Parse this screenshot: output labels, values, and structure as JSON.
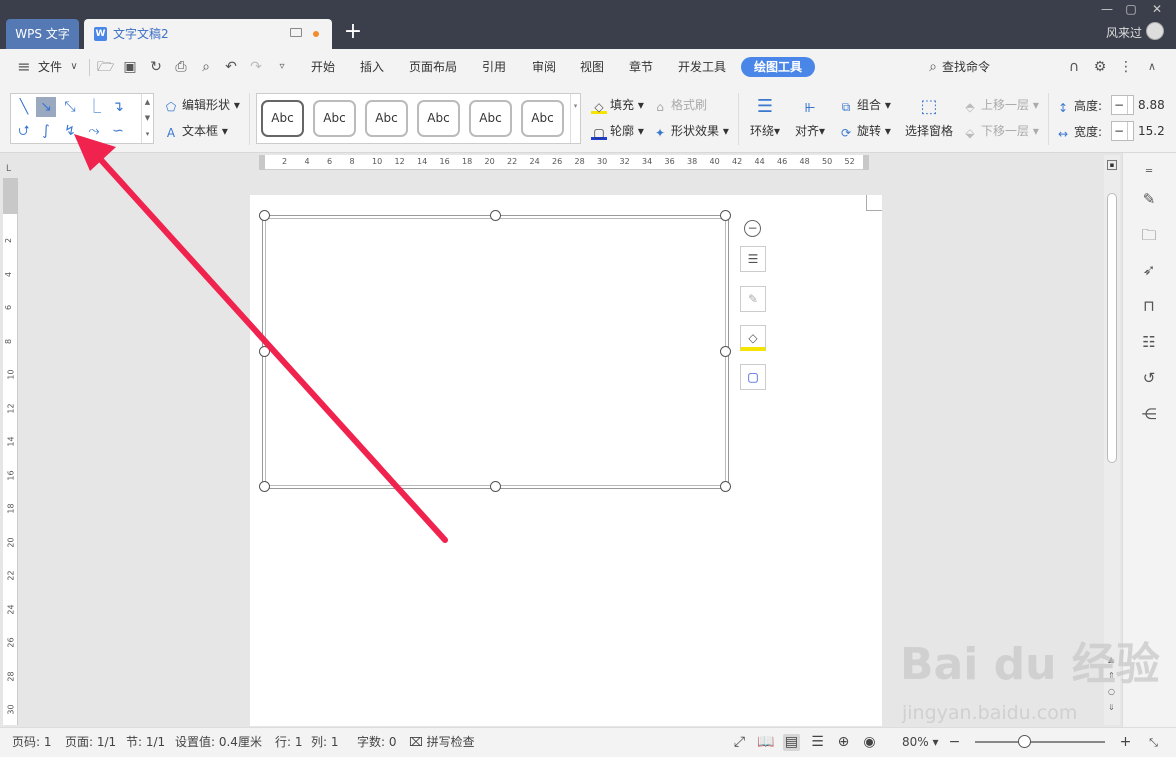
{
  "titlebar": {
    "app_tab": "WPS 文字",
    "doc_tab": "文字文稿2",
    "new_tab": "+",
    "user_name": "风来过"
  },
  "menubar": {
    "file": "文件",
    "tabs": [
      "开始",
      "插入",
      "页面布局",
      "引用",
      "审阅",
      "视图",
      "章节",
      "开发工具"
    ],
    "active_tab": "绘图工具",
    "search": "查找命令"
  },
  "ribbon": {
    "edit_shape": "编辑形状",
    "text_box": "文本框",
    "style_samples": [
      "Abc",
      "Abc",
      "Abc",
      "Abc",
      "Abc",
      "Abc"
    ],
    "fill": "填充",
    "format_painter": "格式刷",
    "outline": "轮廓",
    "shape_effects": "形状效果",
    "wrap": "环绕",
    "align": "对齐",
    "group": "组合",
    "rotate": "旋转",
    "selection_pane": "选择窗格",
    "bring_forward": "上移一层",
    "send_backward": "下移一层",
    "height_label": "高度:",
    "height_value": "8.88",
    "width_label": "宽度:",
    "width_value": "15.2"
  },
  "ruler": {
    "h_ticks": [
      "2",
      "4",
      "6",
      "8",
      "10",
      "12",
      "14",
      "16",
      "18",
      "20",
      "22",
      "24",
      "26",
      "28",
      "30",
      "32",
      "34",
      "36",
      "38",
      "40",
      "42",
      "44",
      "46",
      "48",
      "50",
      "52"
    ],
    "v_ticks": [
      "2",
      "4",
      "6",
      "8",
      "10",
      "12",
      "14",
      "16",
      "18",
      "20",
      "22",
      "24",
      "26",
      "28",
      "30"
    ]
  },
  "statusbar": {
    "page_no": "页码: 1",
    "pages": "页面: 1/1",
    "section": "节: 1/1",
    "setting": "设置值: 0.4厘米",
    "row": "行: 1",
    "col": "列: 1",
    "words": "字数: 0",
    "spellcheck": "拼写检查",
    "zoom": "80%"
  },
  "watermark": {
    "brand": "Bai du 经验",
    "url": "jingyan.baidu.com"
  },
  "colors": {
    "accent": "#4a86e8",
    "titlebar": "#3a3f4b",
    "arrow": "#f0224e"
  },
  "ui_state": {
    "selected_line_tool": "arrow",
    "highlighted_shape": "curved-connector",
    "selected_object": "text-box"
  }
}
